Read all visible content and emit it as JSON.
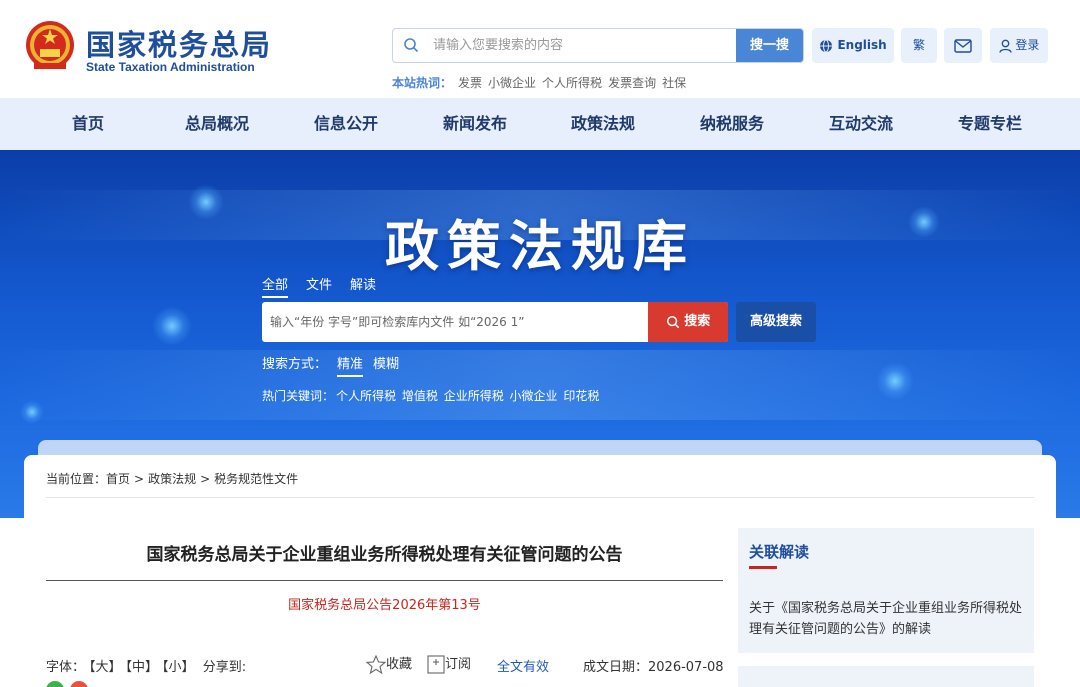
{
  "header": {
    "site_name": "国家税务总局",
    "site_name_en": "State Taxation Administration",
    "search_placeholder": "请输入您要搜索的内容",
    "search_button": "搜一搜",
    "hotwords_label": "本站热词：",
    "hotwords": [
      "发票",
      "小微企业",
      "个人所得税",
      "发票查询",
      "社保"
    ],
    "english_button": "English",
    "traditional_button": "繁",
    "login_button": "登录"
  },
  "nav": {
    "items": [
      "首页",
      "总局概况",
      "信息公开",
      "新闻发布",
      "政策法规",
      "纳税服务",
      "互动交流",
      "专题专栏"
    ]
  },
  "banner": {
    "title": "政策法规库",
    "tabs": [
      "全部",
      "文件",
      "解读"
    ],
    "search_placeholder": "输入“年份 字号”即可检索库内文件 如“2026 1”",
    "search_button": "搜索",
    "advanced_button": "高级搜索",
    "mode_label": "搜索方式：",
    "modes": [
      "精准",
      "模糊"
    ],
    "hot_label": "热门关键词：",
    "hot_keywords": [
      "个人所得税",
      "增值税",
      "企业所得税",
      "小微企业",
      "印花税"
    ]
  },
  "breadcrumb": {
    "label": "当前位置：",
    "items": [
      "首页",
      "政策法规",
      "税务规范性文件"
    ],
    "separator": ">"
  },
  "article": {
    "title": "国家税务总局关于企业重组业务所得税处理有关征管问题的公告",
    "doc_number": "国家税务总局公告2026年第13号",
    "font_label": "字体：",
    "font_large": "【大】",
    "font_medium": "【中】",
    "font_small": "【小】",
    "share_label": "分享到:",
    "favorite": "收藏",
    "subscribe": "订阅",
    "validity": "全文有效",
    "date_label": "成文日期：",
    "date": "2026-07-08"
  },
  "sidebar": {
    "title": "关联解读",
    "link": "关于《国家税务总局关于企业重组业务所得税处理有关征管问题的公告》的解读"
  },
  "colors": {
    "brand_blue": "#1f4e9d",
    "accent_red": "#d93a2f",
    "nav_bg": "#e6effb"
  }
}
